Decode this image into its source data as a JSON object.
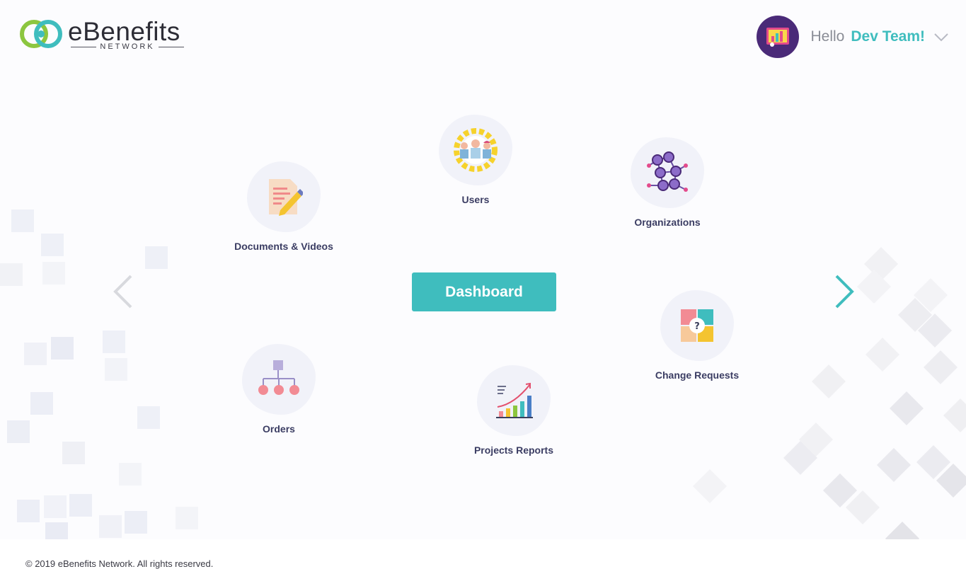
{
  "header": {
    "logo": {
      "name": "eBenefits",
      "sub": "NETWORK"
    },
    "user": {
      "greeting": "Hello",
      "name": "Dev Team!"
    }
  },
  "menu": {
    "documents": "Documents & Videos",
    "users": "Users",
    "organizations": "Organizations",
    "orders": "Orders",
    "projects": "Projects Reports",
    "change_requests": "Change Requests",
    "dashboard": "Dashboard"
  },
  "colors": {
    "accent": "#3fbdbe",
    "label": "#3b3d63",
    "avatar_bg": "#4a2a78"
  },
  "icons": [
    "pencil-document-icon",
    "users-gear-icon",
    "network-icon",
    "org-chart-icon",
    "growth-chart-icon",
    "puzzle-icon",
    "chevron-left-icon",
    "chevron-right-icon",
    "chevron-down-icon"
  ],
  "footer": {
    "copyright": "© 2019 eBenefits Network. All rights reserved."
  }
}
